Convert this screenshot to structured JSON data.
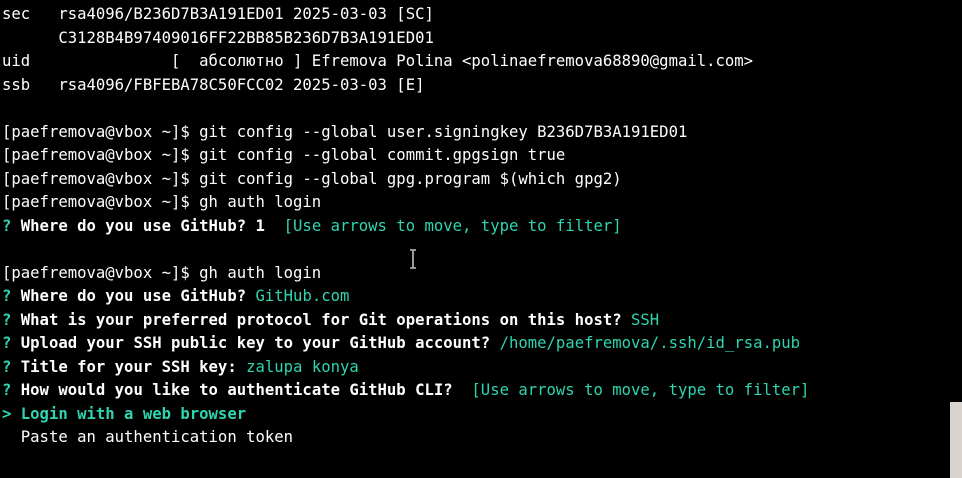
{
  "lines": {
    "l1": "sec   rsa4096/B236D7B3A191ED01 2025-03-03 [SC]",
    "l2": "      C3128B4B97409016FF22BB85B236D7B3A191ED01",
    "l3": "uid               [  абсолютно ] Efremova Polina <polinaefremova68890@gmail.com>",
    "l4": "ssb   rsa4096/FBFEBA78C50FCC02 2025-03-03 [E]",
    "l6": "[paefremova@vbox ~]$ git config --global user.signingkey B236D7B3A191ED01",
    "l7": "[paefremova@vbox ~]$ git config --global commit.gpgsign true",
    "l8": "[paefremova@vbox ~]$ git config --global gpg.program $(which gpg2)",
    "l9": "[paefremova@vbox ~]$ gh auth login",
    "l10_mark": "?",
    "l10_q": " Where do you use GitHub? 1 ",
    "l10_a": " [Use arrows to move, type to filter]",
    "l12": "[paefremova@vbox ~]$ gh auth login",
    "l13_mark": "?",
    "l13_q": " Where do you use GitHub? ",
    "l13_a": "GitHub.com",
    "l14_mark": "?",
    "l14_q": " What is your preferred protocol for Git operations on this host? ",
    "l14_a": "SSH",
    "l15_mark": "?",
    "l15_q": " Upload your SSH public key to your GitHub account? ",
    "l15_a": "/home/paefremova/.ssh/id_rsa.pub",
    "l16_mark": "?",
    "l16_q": " Title for your SSH key: ",
    "l16_a": "zalupa konya",
    "l17_mark": "?",
    "l17_q": " How would you like to authenticate GitHub CLI? ",
    "l17_a": " [Use arrows to move, type to filter]",
    "l18": "> Login with a web browser",
    "l19": "  Paste an authentication token"
  },
  "colors": {
    "background": "#000000",
    "foreground": "#ffffff",
    "accent": "#2fd4b0",
    "scrollbar": "#d9d3d0"
  },
  "icons": {
    "cursor": "i-beam-cursor-icon"
  }
}
